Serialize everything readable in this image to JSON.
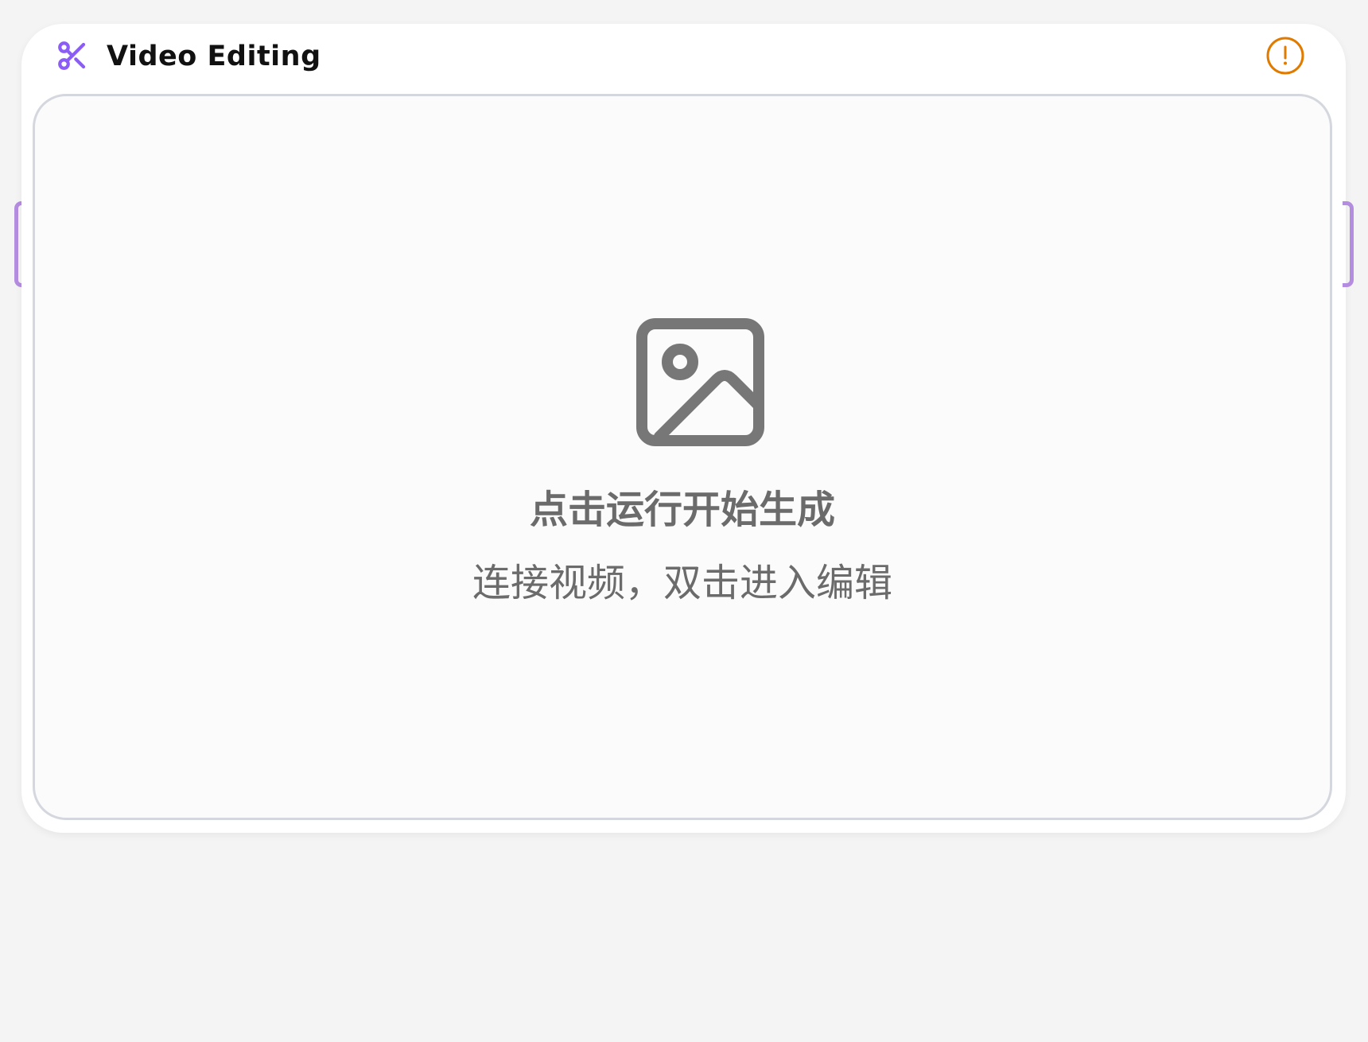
{
  "node": {
    "title": "Video Editing",
    "title_icon": "scissors-icon",
    "status_icon": "warning-circle-icon"
  },
  "preview": {
    "placeholder_icon": "image-icon",
    "hint_primary": "点击运行开始生成",
    "hint_secondary": "连接视频，双击进入编辑"
  },
  "colors": {
    "accent": "#8b5cf6",
    "handle": "#b48ce0",
    "warning": "#e07b00",
    "placeholder": "#777777"
  }
}
